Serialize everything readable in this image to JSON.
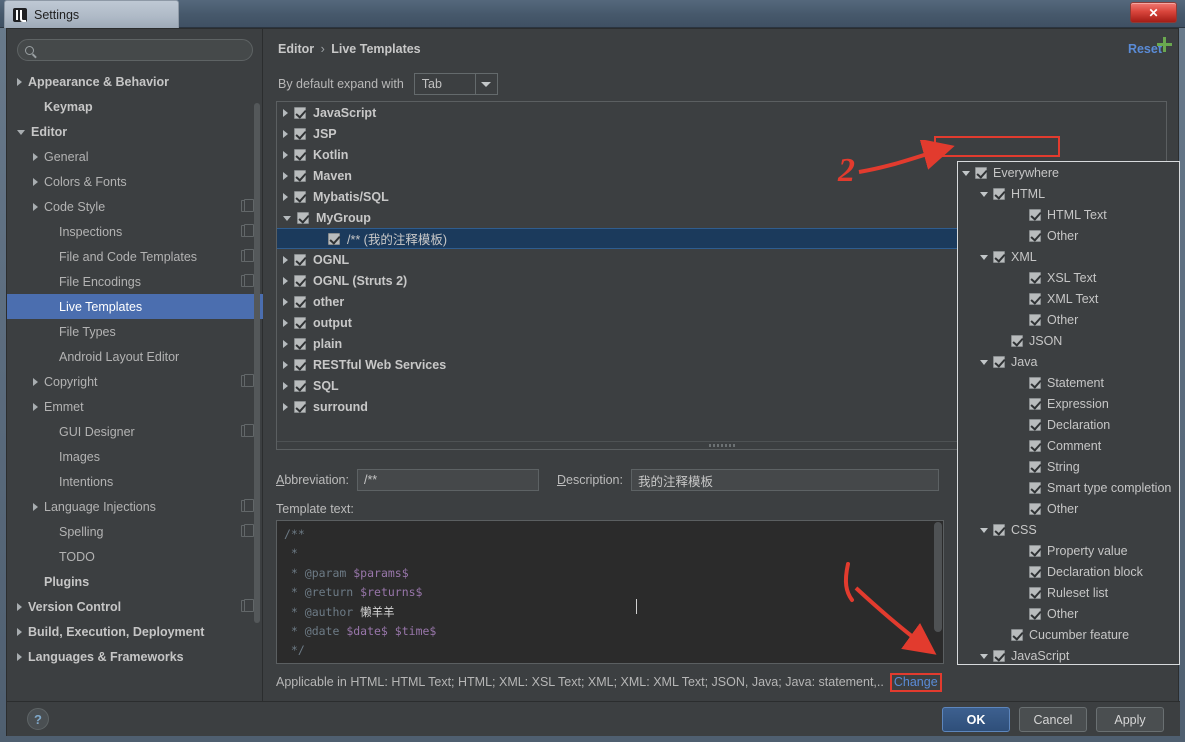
{
  "window": {
    "title": "Settings",
    "close_label": "✕",
    "logo_icon": "intellij-logo-icon"
  },
  "sidebar": {
    "search": {
      "value": "",
      "placeholder": ""
    },
    "items": [
      {
        "label": "Appearance & Behavior",
        "arrow": "right",
        "bold": true,
        "indent": 10,
        "copy": false
      },
      {
        "label": "Keymap",
        "arrow": "none",
        "bold": true,
        "indent": 26,
        "copy": false
      },
      {
        "label": "Editor",
        "arrow": "down",
        "bold": true,
        "indent": 10,
        "copy": false
      },
      {
        "label": "General",
        "arrow": "right",
        "bold": false,
        "indent": 26,
        "copy": false
      },
      {
        "label": "Colors & Fonts",
        "arrow": "right",
        "bold": false,
        "indent": 26,
        "copy": false
      },
      {
        "label": "Code Style",
        "arrow": "right",
        "bold": false,
        "indent": 26,
        "copy": true
      },
      {
        "label": "Inspections",
        "arrow": "none",
        "bold": false,
        "indent": 41,
        "copy": true
      },
      {
        "label": "File and Code Templates",
        "arrow": "none",
        "bold": false,
        "indent": 41,
        "copy": true
      },
      {
        "label": "File Encodings",
        "arrow": "none",
        "bold": false,
        "indent": 41,
        "copy": true
      },
      {
        "label": "Live Templates",
        "arrow": "none",
        "bold": false,
        "indent": 41,
        "copy": false,
        "selected": true
      },
      {
        "label": "File Types",
        "arrow": "none",
        "bold": false,
        "indent": 41,
        "copy": false
      },
      {
        "label": "Android Layout Editor",
        "arrow": "none",
        "bold": false,
        "indent": 41,
        "copy": false
      },
      {
        "label": "Copyright",
        "arrow": "right",
        "bold": false,
        "indent": 26,
        "copy": true
      },
      {
        "label": "Emmet",
        "arrow": "right",
        "bold": false,
        "indent": 26,
        "copy": false
      },
      {
        "label": "GUI Designer",
        "arrow": "none",
        "bold": false,
        "indent": 41,
        "copy": true
      },
      {
        "label": "Images",
        "arrow": "none",
        "bold": false,
        "indent": 41,
        "copy": false
      },
      {
        "label": "Intentions",
        "arrow": "none",
        "bold": false,
        "indent": 41,
        "copy": false
      },
      {
        "label": "Language Injections",
        "arrow": "right",
        "bold": false,
        "indent": 26,
        "copy": true
      },
      {
        "label": "Spelling",
        "arrow": "none",
        "bold": false,
        "indent": 41,
        "copy": true
      },
      {
        "label": "TODO",
        "arrow": "none",
        "bold": false,
        "indent": 41,
        "copy": false
      },
      {
        "label": "Plugins",
        "arrow": "none",
        "bold": true,
        "indent": 26,
        "copy": false
      },
      {
        "label": "Version Control",
        "arrow": "right",
        "bold": true,
        "indent": 10,
        "copy": true
      },
      {
        "label": "Build, Execution, Deployment",
        "arrow": "right",
        "bold": true,
        "indent": 10,
        "copy": false
      },
      {
        "label": "Languages & Frameworks",
        "arrow": "right",
        "bold": true,
        "indent": 10,
        "copy": false
      }
    ]
  },
  "main": {
    "breadcrumb_root": "Editor",
    "breadcrumb_sep": "›",
    "breadcrumb_leaf": "Live Templates",
    "reset_label": "Reset",
    "expand_label": "By default expand with",
    "expand_value": "Tab",
    "add_button_label": "+",
    "templates": [
      {
        "label": "JavaScript",
        "arrow": "right",
        "indent": 6,
        "checked": true,
        "leaf": false
      },
      {
        "label": "JSP",
        "arrow": "right",
        "indent": 6,
        "checked": true,
        "leaf": false
      },
      {
        "label": "Kotlin",
        "arrow": "right",
        "indent": 6,
        "checked": true,
        "leaf": false
      },
      {
        "label": "Maven",
        "arrow": "right",
        "indent": 6,
        "checked": true,
        "leaf": false
      },
      {
        "label": "Mybatis/SQL",
        "arrow": "right",
        "indent": 6,
        "checked": true,
        "leaf": false
      },
      {
        "label": "MyGroup",
        "arrow": "down",
        "indent": 6,
        "checked": true,
        "leaf": false
      },
      {
        "label": "/** (我的注释模板)",
        "arrow": "none",
        "indent": 40,
        "checked": true,
        "leaf": true,
        "selected": true
      },
      {
        "label": "OGNL",
        "arrow": "right",
        "indent": 6,
        "checked": true,
        "leaf": false
      },
      {
        "label": "OGNL (Struts 2)",
        "arrow": "right",
        "indent": 6,
        "checked": true,
        "leaf": false
      },
      {
        "label": "other",
        "arrow": "right",
        "indent": 6,
        "checked": true,
        "leaf": false
      },
      {
        "label": "output",
        "arrow": "right",
        "indent": 6,
        "checked": true,
        "leaf": false
      },
      {
        "label": "plain",
        "arrow": "right",
        "indent": 6,
        "checked": true,
        "leaf": false
      },
      {
        "label": "RESTful Web Services",
        "arrow": "right",
        "indent": 6,
        "checked": true,
        "leaf": false
      },
      {
        "label": "SQL",
        "arrow": "right",
        "indent": 6,
        "checked": true,
        "leaf": false
      },
      {
        "label": "surround",
        "arrow": "right",
        "indent": 6,
        "checked": true,
        "leaf": false
      }
    ],
    "abbreviation_label": "Abbreviation:",
    "abbreviation_value": "/**",
    "description_label": "Description:",
    "description_value": "我的注释模板",
    "template_text_label": "Template text:",
    "template_text_lines": [
      "/**",
      " *",
      " * @param $params$",
      " * @return $returns$",
      " * @author 懒羊羊",
      " * @date $date$ $time$",
      " */"
    ],
    "applicable_text": "Applicable in HTML: HTML Text; HTML; XML: XSL Text; XML; XML: XML Text; JSON, Java; Java: statement,..",
    "change_link": "Change"
  },
  "context_panel": {
    "items": [
      {
        "label": "Everywhere",
        "indent": 4,
        "arrow": "down",
        "checked": true,
        "highlighted": true
      },
      {
        "label": "HTML",
        "indent": 22,
        "arrow": "down",
        "checked": true
      },
      {
        "label": "HTML Text",
        "indent": 58,
        "arrow": "none",
        "checked": true
      },
      {
        "label": "Other",
        "indent": 58,
        "arrow": "none",
        "checked": true
      },
      {
        "label": "XML",
        "indent": 22,
        "arrow": "down",
        "checked": true
      },
      {
        "label": "XSL Text",
        "indent": 58,
        "arrow": "none",
        "checked": true
      },
      {
        "label": "XML Text",
        "indent": 58,
        "arrow": "none",
        "checked": true
      },
      {
        "label": "Other",
        "indent": 58,
        "arrow": "none",
        "checked": true
      },
      {
        "label": "JSON",
        "indent": 40,
        "arrow": "none",
        "checked": true
      },
      {
        "label": "Java",
        "indent": 22,
        "arrow": "down",
        "checked": true
      },
      {
        "label": "Statement",
        "indent": 58,
        "arrow": "none",
        "checked": true
      },
      {
        "label": "Expression",
        "indent": 58,
        "arrow": "none",
        "checked": true
      },
      {
        "label": "Declaration",
        "indent": 58,
        "arrow": "none",
        "checked": true
      },
      {
        "label": "Comment",
        "indent": 58,
        "arrow": "none",
        "checked": true
      },
      {
        "label": "String",
        "indent": 58,
        "arrow": "none",
        "checked": true
      },
      {
        "label": "Smart type completion",
        "indent": 58,
        "arrow": "none",
        "checked": true
      },
      {
        "label": "Other",
        "indent": 58,
        "arrow": "none",
        "checked": true
      },
      {
        "label": "CSS",
        "indent": 22,
        "arrow": "down",
        "checked": true
      },
      {
        "label": "Property value",
        "indent": 58,
        "arrow": "none",
        "checked": true
      },
      {
        "label": "Declaration block",
        "indent": 58,
        "arrow": "none",
        "checked": true
      },
      {
        "label": "Ruleset list",
        "indent": 58,
        "arrow": "none",
        "checked": true
      },
      {
        "label": "Other",
        "indent": 58,
        "arrow": "none",
        "checked": true
      },
      {
        "label": "Cucumber feature",
        "indent": 40,
        "arrow": "none",
        "checked": true
      },
      {
        "label": "JavaScript",
        "indent": 22,
        "arrow": "down",
        "checked": true
      }
    ]
  },
  "annotations": {
    "step_two": "2",
    "highlight_color": "#e23b2e"
  },
  "footer": {
    "help_label": "?",
    "buttons": [
      {
        "label": "OK",
        "primary": true
      },
      {
        "label": "Cancel",
        "primary": false
      },
      {
        "label": "Apply",
        "primary": false
      }
    ]
  }
}
